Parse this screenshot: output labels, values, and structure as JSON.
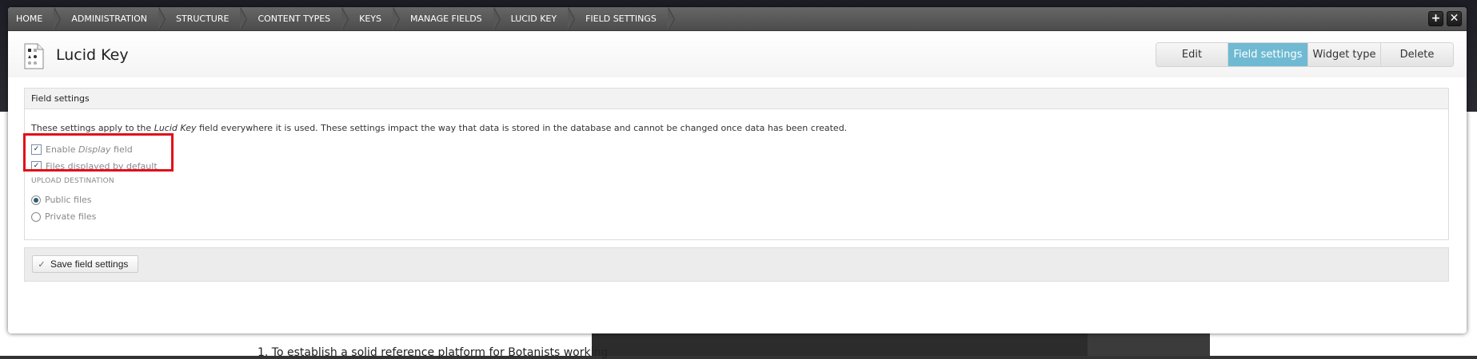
{
  "breadcrumb": [
    "Home",
    "Administration",
    "Structure",
    "Content types",
    "Keys",
    "Manage fields",
    "Lucid Key",
    "Field settings"
  ],
  "toolbar": {
    "add_label": "+",
    "close_label": "✕"
  },
  "page": {
    "title": "Lucid Key",
    "icon": "lucid-key-document-icon"
  },
  "tabs": [
    {
      "label": "Edit",
      "active": false
    },
    {
      "label": "Field settings",
      "active": true
    },
    {
      "label": "Widget type",
      "active": false
    },
    {
      "label": "Delete",
      "active": false
    }
  ],
  "fieldset": {
    "legend": "Field settings",
    "description_pre": "These settings apply to the ",
    "description_em": "Lucid Key",
    "description_post": " field everywhere it is used. These settings impact the way that data is stored in the database and cannot be changed once data has been created.",
    "enable_display_pre": "Enable ",
    "enable_display_em": "Display",
    "enable_display_post": " field",
    "enable_display_checked": true,
    "files_displayed_label": "Files displayed by default",
    "files_displayed_checked": true,
    "upload_destination_label": "Upload destination",
    "upload_options": [
      {
        "label": "Public files",
        "selected": true
      },
      {
        "label": "Private files",
        "selected": false
      }
    ]
  },
  "actions": {
    "save_label": "Save field settings",
    "save_icon": "check-icon"
  },
  "background": {
    "text": "1.   To establish a solid reference platform for Botanists working"
  },
  "colors": {
    "active_tab": "#6fbad2",
    "highlight": "#e0101a",
    "toolbar": "#575757"
  }
}
